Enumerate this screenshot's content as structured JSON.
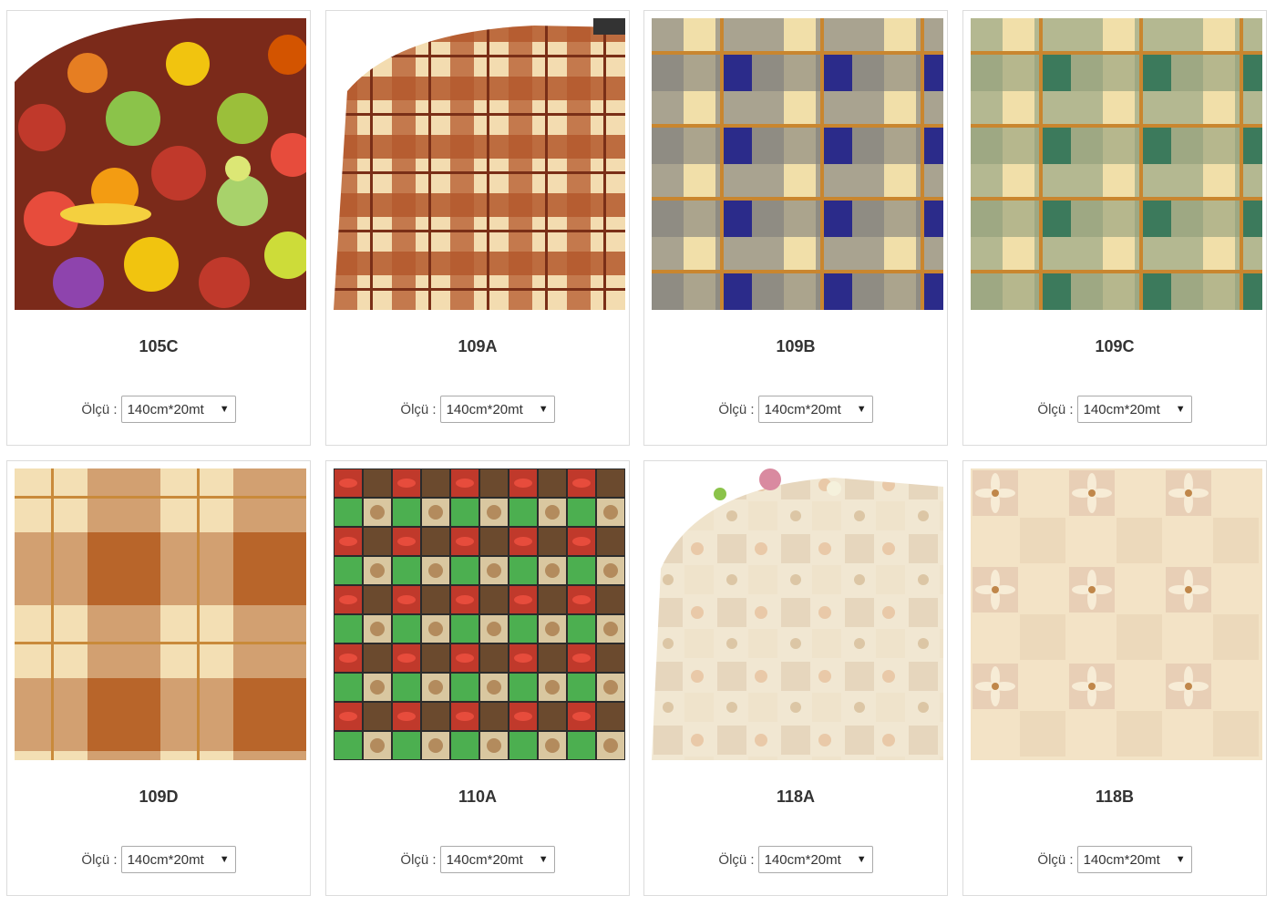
{
  "products": [
    {
      "code": "105C",
      "size_label": "Ölçü :",
      "size_value": "140cm*20mt",
      "pattern": "fruits"
    },
    {
      "code": "109A",
      "size_label": "Ölçü :",
      "size_value": "140cm*20mt",
      "pattern": "plaid-rust-table"
    },
    {
      "code": "109B",
      "size_label": "Ölçü :",
      "size_value": "140cm*20mt",
      "pattern": "plaid-navy"
    },
    {
      "code": "109C",
      "size_label": "Ölçü :",
      "size_value": "140cm*20mt",
      "pattern": "plaid-green"
    },
    {
      "code": "109D",
      "size_label": "Ölçü :",
      "size_value": "140cm*20mt",
      "pattern": "plaid-brown"
    },
    {
      "code": "110A",
      "size_label": "Ölçü :",
      "size_value": "140cm*20mt",
      "pattern": "vegetables"
    },
    {
      "code": "118A",
      "size_label": "Ölçü :",
      "size_value": "140cm*20mt",
      "pattern": "lily-table"
    },
    {
      "code": "118B",
      "size_label": "Ölçü :",
      "size_value": "140cm*20mt",
      "pattern": "lily-tiles"
    }
  ],
  "icons": {
    "dropdown": "caret-down-icon"
  },
  "colors": {
    "border": "#dcdcdc",
    "text": "#333333",
    "plaid_cream": "#f1dfa9",
    "plaid_rust": "#b4582c",
    "plaid_navy": "#2b2b8a",
    "plaid_green": "#3c7a5c",
    "plaid_brown": "#b8652a"
  }
}
